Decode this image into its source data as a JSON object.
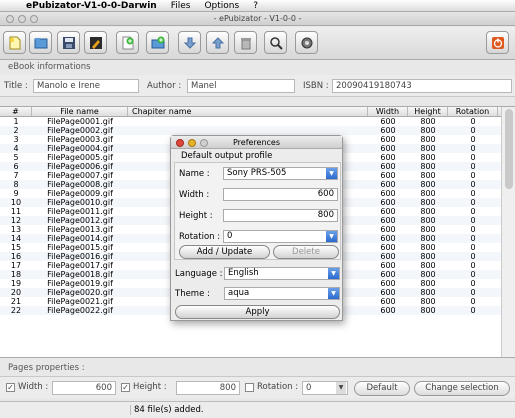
{
  "menubar": {
    "app_name": "ePubizator-V1-0-0-Darwin",
    "menus": [
      "Files",
      "Options",
      "?"
    ]
  },
  "window": {
    "title": "- ePubizator - V1-0-0 -"
  },
  "toolbar": {
    "icons": [
      "new-document-icon",
      "open-folder-icon",
      "save-icon",
      "edit-icon",
      "add-file-icon",
      "add-folder-icon",
      "move-down-icon",
      "move-up-icon",
      "trash-icon",
      "search-icon",
      "settings-icon",
      "power-icon"
    ]
  },
  "ebook_info": {
    "section_label": "eBook informations",
    "title_label": "Title :",
    "title_value": "Manolo e Irene",
    "author_label": "Author :",
    "author_value": "Manel",
    "isbn_label": "ISBN :",
    "isbn_value": "20090419180743"
  },
  "table": {
    "columns": [
      "#",
      "File name",
      "Chapiter name",
      "Width",
      "Height",
      "Rotation"
    ],
    "rows": [
      [
        "1",
        "FilePage0001.gif",
        "",
        "600",
        "800",
        "0"
      ],
      [
        "2",
        "FilePage0002.gif",
        "",
        "600",
        "800",
        "0"
      ],
      [
        "3",
        "FilePage0003.gif",
        "",
        "600",
        "800",
        "0"
      ],
      [
        "4",
        "FilePage0004.gif",
        "",
        "600",
        "800",
        "0"
      ],
      [
        "5",
        "FilePage0005.gif",
        "",
        "600",
        "800",
        "0"
      ],
      [
        "6",
        "FilePage0006.gif",
        "",
        "600",
        "800",
        "0"
      ],
      [
        "7",
        "FilePage0007.gif",
        "",
        "600",
        "800",
        "0"
      ],
      [
        "8",
        "FilePage0008.gif",
        "",
        "600",
        "800",
        "0"
      ],
      [
        "9",
        "FilePage0009.gif",
        "",
        "600",
        "800",
        "0"
      ],
      [
        "10",
        "FilePage0010.gif",
        "",
        "600",
        "800",
        "0"
      ],
      [
        "11",
        "FilePage0011.gif",
        "",
        "600",
        "800",
        "0"
      ],
      [
        "12",
        "FilePage0012.gif",
        "",
        "600",
        "800",
        "0"
      ],
      [
        "13",
        "FilePage0013.gif",
        "",
        "600",
        "800",
        "0"
      ],
      [
        "14",
        "FilePage0014.gif",
        "",
        "600",
        "800",
        "0"
      ],
      [
        "15",
        "FilePage0015.gif",
        "",
        "600",
        "800",
        "0"
      ],
      [
        "16",
        "FilePage0016.gif",
        "",
        "600",
        "800",
        "0"
      ],
      [
        "17",
        "FilePage0017.gif",
        "",
        "600",
        "800",
        "0"
      ],
      [
        "18",
        "FilePage0018.gif",
        "",
        "600",
        "800",
        "0"
      ],
      [
        "19",
        "FilePage0019.gif",
        "",
        "600",
        "800",
        "0"
      ],
      [
        "20",
        "FilePage0020.gif",
        "",
        "600",
        "800",
        "0"
      ],
      [
        "21",
        "FilePage0021.gif",
        "",
        "600",
        "800",
        "0"
      ],
      [
        "22",
        "FilePage0022.gif",
        "",
        "600",
        "800",
        "0"
      ]
    ]
  },
  "pages_properties": {
    "section_label": "Pages properties :",
    "width_label": "Width :",
    "width_value": "600",
    "height_label": "Height :",
    "height_value": "800",
    "rotation_label": "Rotation :",
    "rotation_value": "0",
    "default_button": "Default",
    "change_button": "Change selection"
  },
  "status": {
    "message": "84 file(s) added."
  },
  "preferences": {
    "title": "Preferences",
    "group_title": "Default output profile",
    "name_label": "Name :",
    "name_value": "Sony PRS-505",
    "width_label": "Width :",
    "width_value": "600",
    "height_label": "Height :",
    "height_value": "800",
    "rotation_label": "Rotation :",
    "rotation_value": "0",
    "add_update_button": "Add / Update",
    "delete_button": "Delete",
    "language_label": "Language :",
    "language_value": "English",
    "theme_label": "Theme :",
    "theme_value": "aqua",
    "apply_button": "Apply"
  }
}
